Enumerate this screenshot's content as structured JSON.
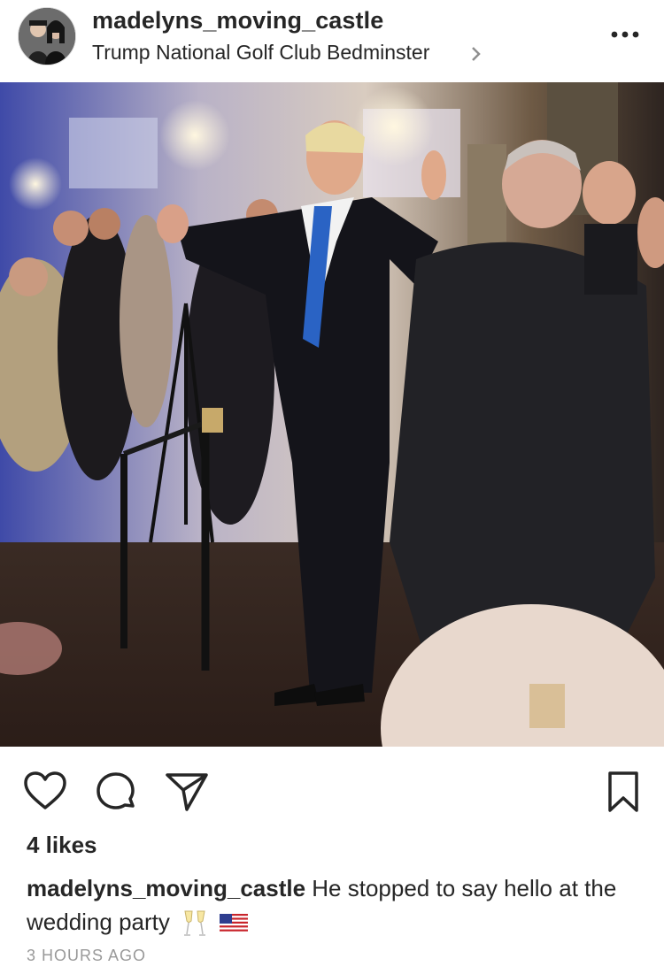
{
  "post": {
    "username": "madelyns_moving_castle",
    "location": "Trump National Golf Club Bedminster",
    "photo_alt": "",
    "likes_text": "4 likes",
    "caption_user": "madelyns_moving_castle",
    "caption_text": "He stopped to say hello at the wedding party",
    "caption_emojis": [
      "champagne-glasses-icon",
      "us-flag-icon"
    ],
    "time_ago": "3 HOURS AGO"
  },
  "icons": {
    "more": "more-icon",
    "chevron": "chevron-right-icon",
    "like": "heart-icon",
    "comment": "comment-icon",
    "share": "paper-plane-icon",
    "save": "bookmark-icon"
  }
}
